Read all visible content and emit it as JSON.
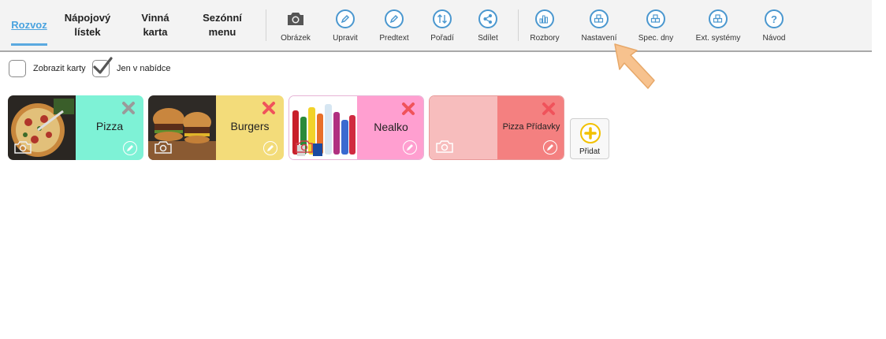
{
  "tabs": [
    {
      "label": "Rozvoz",
      "active": true
    },
    {
      "label": "Nápojový lístek",
      "line1": "Nápojový",
      "line2": "lístek",
      "active": false
    },
    {
      "label": "Vinná karta",
      "line1": "Vinná",
      "line2": "karta",
      "active": false
    },
    {
      "label": "Sezónní menu",
      "line1": "Sezónní",
      "line2": "menu",
      "active": false
    }
  ],
  "toolbar": [
    {
      "label": "Obrázek",
      "icon": "camera-icon"
    },
    {
      "label": "Upravit",
      "icon": "pencil-icon"
    },
    {
      "label": "Predtext",
      "icon": "pencil-icon"
    },
    {
      "label": "Pořadí",
      "icon": "sort-arrows-icon"
    },
    {
      "label": "Sdílet",
      "icon": "share-icon"
    },
    {
      "label": "Rozbory",
      "icon": "bar-chart-icon"
    },
    {
      "label": "Nastavení",
      "icon": "blocks-icon"
    },
    {
      "label": "Spec. dny",
      "icon": "blocks-icon"
    },
    {
      "label": "Ext. systémy",
      "icon": "blocks-icon"
    },
    {
      "label": "Návod",
      "icon": "question-icon"
    }
  ],
  "filters": {
    "show_cards": {
      "label": "Zobrazit karty",
      "checked": false
    },
    "only_in_offer": {
      "label": "Jen v nabídce",
      "checked": true
    }
  },
  "categories": [
    {
      "name": "Pizza",
      "color": "#7ef2d6",
      "image": "pizza-photo"
    },
    {
      "name": "Burgers",
      "color": "#f3dc7a",
      "image": "burgers-photo"
    },
    {
      "name": "Nealko",
      "color": "#ff9fd0",
      "image": "drinks-photo"
    },
    {
      "name": "Pizza Přídavky",
      "color": "#f48080",
      "image_placeholder_color": "#f7bdbd"
    }
  ],
  "add_button": {
    "label": "Přidat"
  },
  "colors": {
    "accent_blue": "#4a97cf",
    "delete_x_pizza": "#9a9a9a",
    "delete_x_red": "#f0535b",
    "add_plus": "#f2c100",
    "pointer_arrow": "#f7c28e"
  }
}
